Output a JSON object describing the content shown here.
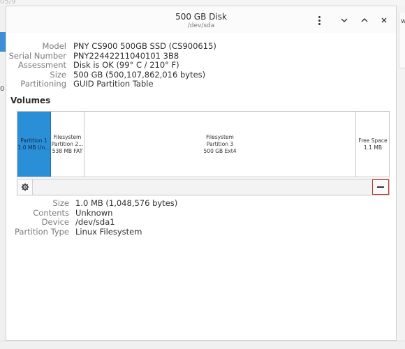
{
  "background": {
    "crumb": "05/9",
    "left_char": "0",
    "right_char": "w"
  },
  "window": {
    "title": "500 GB Disk",
    "subtitle": "/dev/sda",
    "menu_icon": "vertical-dots-icon",
    "minimize_icon": "chevron-down-icon",
    "maximize_icon": "chevron-up-icon",
    "close_icon": "close-icon"
  },
  "disk_info": [
    {
      "label": "Model",
      "value": "PNY CS900 500GB SSD (CS900615)"
    },
    {
      "label": "Serial Number",
      "value": "PNY22442211040101 3B8"
    },
    {
      "label": "Assessment",
      "value": "Disk is OK (99° C / 210° F)"
    },
    {
      "label": "Size",
      "value": "500 GB (500,107,862,016 bytes)"
    },
    {
      "label": "Partitioning",
      "value": "GUID Partition Table"
    }
  ],
  "volumes": {
    "title": "Volumes",
    "items": [
      {
        "line1": "Partition 1",
        "line2": "1.0 MB Un...",
        "line3": "",
        "selected": true
      },
      {
        "line1": "Filesystem",
        "line2": "Partition 2...",
        "line3": "538 MB FAT",
        "selected": false
      },
      {
        "line1": "Filesystem",
        "line2": "Partition 3",
        "line3": "500 GB Ext4",
        "selected": false
      },
      {
        "line1": "Free Space",
        "line2": "1.1 MB",
        "line3": "",
        "selected": false
      }
    ],
    "selected_color": "#2b8fd8"
  },
  "toolbar": {
    "gear_icon": "gear-icon",
    "remove_icon": "minus-icon"
  },
  "partition_details": [
    {
      "label": "Size",
      "value": "1.0 MB (1,048,576 bytes)"
    },
    {
      "label": "Contents",
      "value": "Unknown"
    },
    {
      "label": "Device",
      "value": "/dev/sda1"
    },
    {
      "label": "Partition Type",
      "value": "Linux Filesystem"
    }
  ]
}
